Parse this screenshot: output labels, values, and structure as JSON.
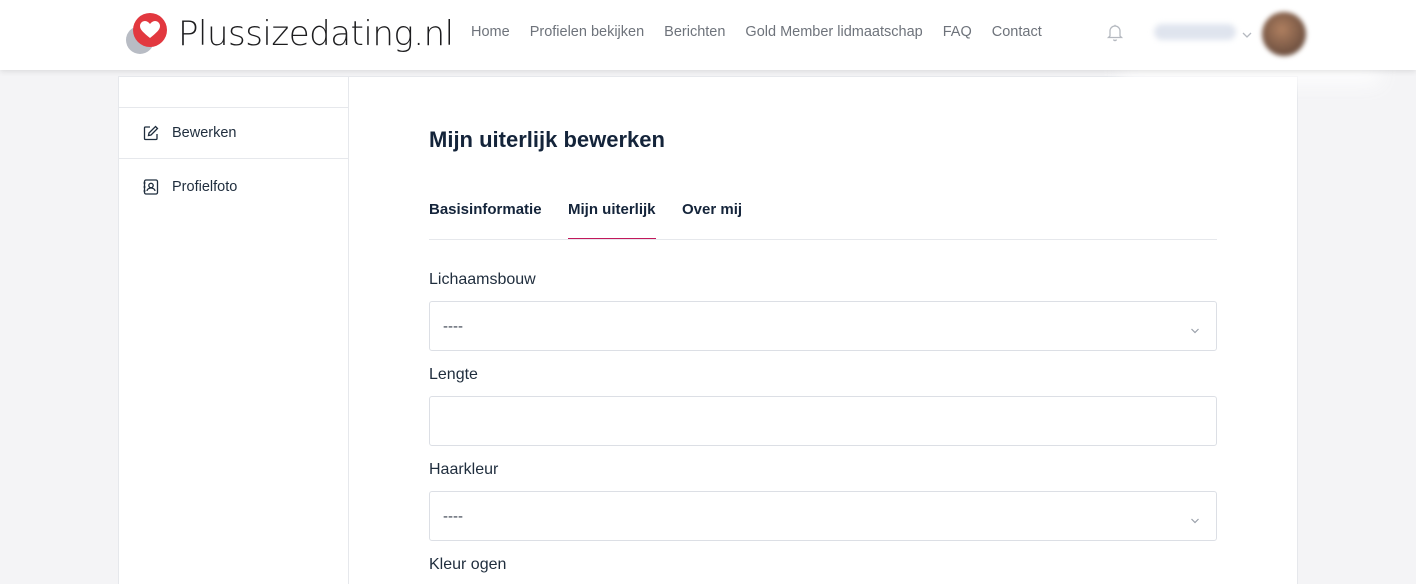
{
  "brand": {
    "name": "Plussizedating.nl",
    "accent": "#e2383f"
  },
  "nav": {
    "items": [
      "Home",
      "Profielen bekijken",
      "Berichten",
      "Gold Member lidmaatschap",
      "FAQ",
      "Contact"
    ]
  },
  "header_icons": {
    "notifications": "bell-icon",
    "menu": "chevron-down-icon"
  },
  "sidebar": {
    "items": [
      {
        "label": "Bewerken",
        "icon": "edit-icon"
      },
      {
        "label": "Profielfoto",
        "icon": "profile-photo-icon"
      }
    ]
  },
  "main": {
    "title": "Mijn uiterlijk bewerken",
    "tabs": [
      "Basisinformatie",
      "Mijn uiterlijk",
      "Over mij"
    ],
    "active_tab": "Mijn uiterlijk",
    "fields": [
      {
        "label": "Lichaamsbouw",
        "type": "select",
        "value": "----"
      },
      {
        "label": "Lengte",
        "type": "text",
        "value": ""
      },
      {
        "label": "Haarkleur",
        "type": "select",
        "value": "----"
      },
      {
        "label": "Kleur ogen"
      }
    ]
  }
}
